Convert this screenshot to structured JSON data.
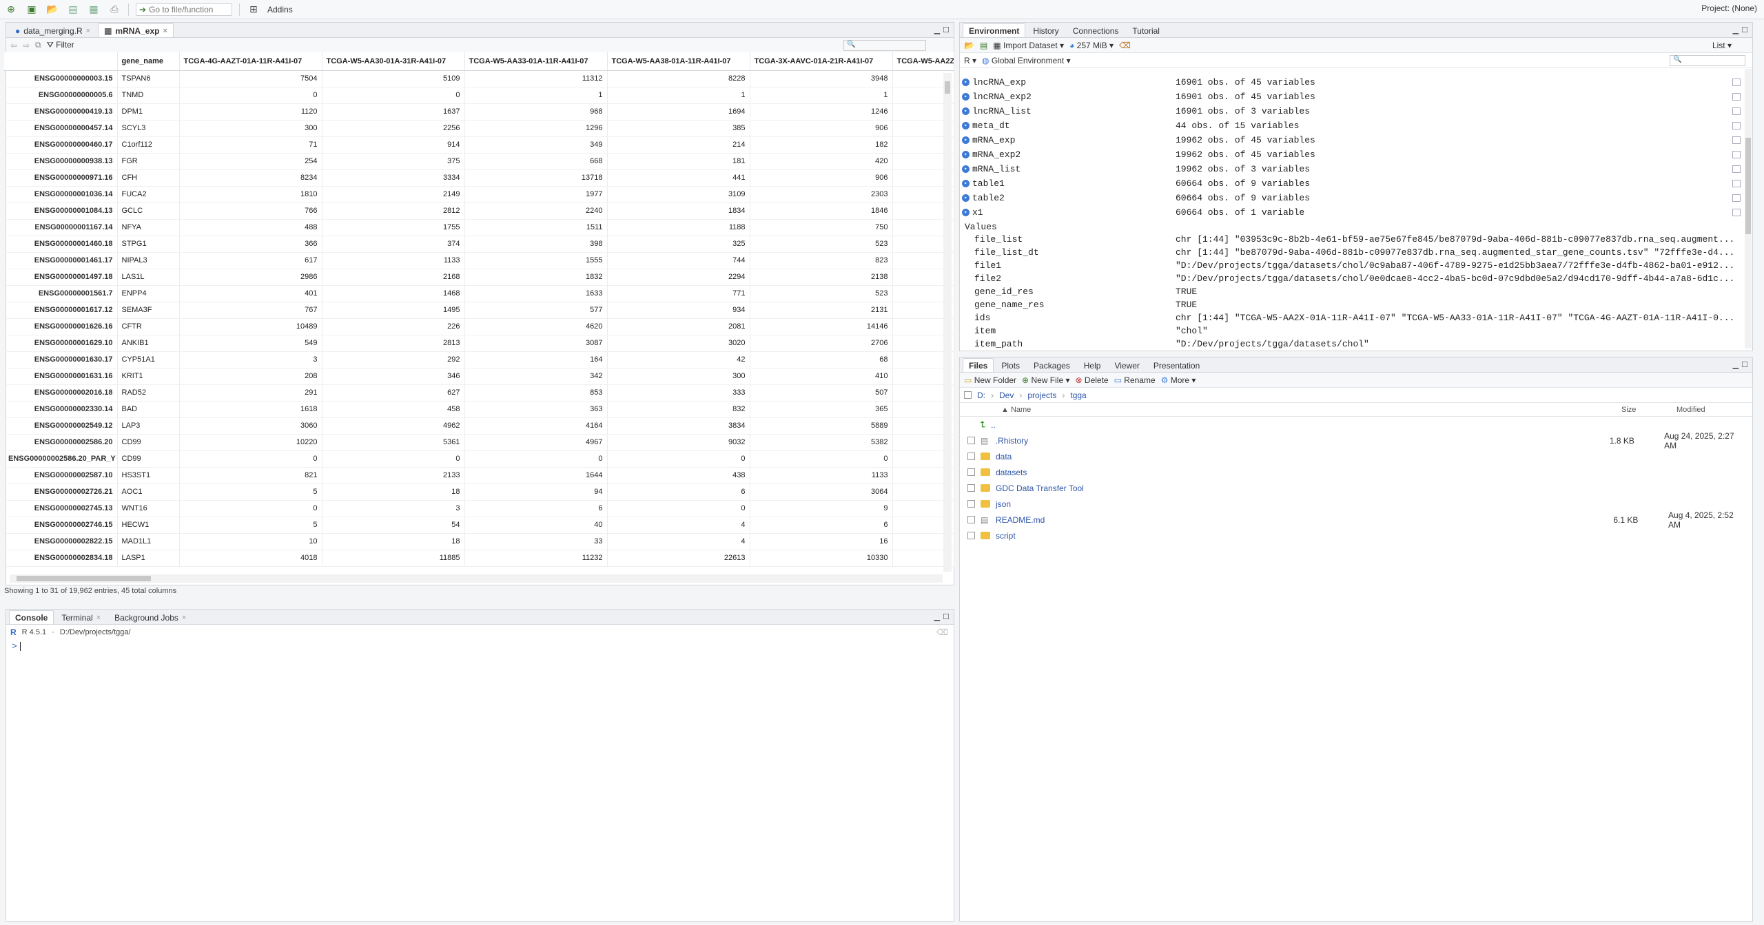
{
  "toolbar": {
    "goto_placeholder": "Go to file/function",
    "addins": "Addins",
    "project": "Project: (None)"
  },
  "source": {
    "tabs": [
      "data_merging.R",
      "mRNA_exp"
    ],
    "filter": "Filter",
    "columns": [
      "gene_name",
      "TCGA-4G-AAZT-01A-11R-A41I-07",
      "TCGA-W5-AA30-01A-31R-A41I-07",
      "TCGA-W5-AA33-01A-11R-A41I-07",
      "TCGA-W5-AA38-01A-11R-A41I-07",
      "TCGA-3X-AAVC-01A-21R-A41I-07",
      "TCGA-W5-AA2Z"
    ],
    "rows": [
      [
        "ENSG00000000003.15",
        "TSPAN6",
        "7504",
        "5109",
        "11312",
        "8228",
        "3948"
      ],
      [
        "ENSG00000000005.6",
        "TNMD",
        "0",
        "0",
        "1",
        "1",
        "1"
      ],
      [
        "ENSG00000000419.13",
        "DPM1",
        "1120",
        "1637",
        "968",
        "1694",
        "1246"
      ],
      [
        "ENSG00000000457.14",
        "SCYL3",
        "300",
        "2256",
        "1296",
        "385",
        "906"
      ],
      [
        "ENSG00000000460.17",
        "C1orf112",
        "71",
        "914",
        "349",
        "214",
        "182"
      ],
      [
        "ENSG00000000938.13",
        "FGR",
        "254",
        "375",
        "668",
        "181",
        "420"
      ],
      [
        "ENSG00000000971.16",
        "CFH",
        "8234",
        "3334",
        "13718",
        "441",
        "906"
      ],
      [
        "ENSG00000001036.14",
        "FUCA2",
        "1810",
        "2149",
        "1977",
        "3109",
        "2303"
      ],
      [
        "ENSG00000001084.13",
        "GCLC",
        "766",
        "2812",
        "2240",
        "1834",
        "1846"
      ],
      [
        "ENSG00000001167.14",
        "NFYA",
        "488",
        "1755",
        "1511",
        "1188",
        "750"
      ],
      [
        "ENSG00000001460.18",
        "STPG1",
        "366",
        "374",
        "398",
        "325",
        "523"
      ],
      [
        "ENSG00000001461.17",
        "NIPAL3",
        "617",
        "1133",
        "1555",
        "744",
        "823"
      ],
      [
        "ENSG00000001497.18",
        "LAS1L",
        "2986",
        "2168",
        "1832",
        "2294",
        "2138"
      ],
      [
        "ENSG00000001561.7",
        "ENPP4",
        "401",
        "1468",
        "1633",
        "771",
        "523"
      ],
      [
        "ENSG00000001617.12",
        "SEMA3F",
        "767",
        "1495",
        "577",
        "934",
        "2131"
      ],
      [
        "ENSG00000001626.16",
        "CFTR",
        "10489",
        "226",
        "4620",
        "2081",
        "14146"
      ],
      [
        "ENSG00000001629.10",
        "ANKIB1",
        "549",
        "2813",
        "3087",
        "3020",
        "2706"
      ],
      [
        "ENSG00000001630.17",
        "CYP51A1",
        "3",
        "292",
        "164",
        "42",
        "68"
      ],
      [
        "ENSG00000001631.16",
        "KRIT1",
        "208",
        "346",
        "342",
        "300",
        "410"
      ],
      [
        "ENSG00000002016.18",
        "RAD52",
        "291",
        "627",
        "853",
        "333",
        "507"
      ],
      [
        "ENSG00000002330.14",
        "BAD",
        "1618",
        "458",
        "363",
        "832",
        "365"
      ],
      [
        "ENSG00000002549.12",
        "LAP3",
        "3060",
        "4962",
        "4164",
        "3834",
        "5889"
      ],
      [
        "ENSG00000002586.20",
        "CD99",
        "10220",
        "5361",
        "4967",
        "9032",
        "5382"
      ],
      [
        "ENSG00000002586.20_PAR_Y",
        "CD99",
        "0",
        "0",
        "0",
        "0",
        "0"
      ],
      [
        "ENSG00000002587.10",
        "HS3ST1",
        "821",
        "2133",
        "1644",
        "438",
        "1133"
      ],
      [
        "ENSG00000002726.21",
        "AOC1",
        "5",
        "18",
        "94",
        "6",
        "3064"
      ],
      [
        "ENSG00000002745.13",
        "WNT16",
        "0",
        "3",
        "6",
        "0",
        "9"
      ],
      [
        "ENSG00000002746.15",
        "HECW1",
        "5",
        "54",
        "40",
        "4",
        "6"
      ],
      [
        "ENSG00000002822.15",
        "MAD1L1",
        "10",
        "18",
        "33",
        "4",
        "16"
      ],
      [
        "ENSG00000002834.18",
        "LASP1",
        "4018",
        "11885",
        "11232",
        "22613",
        "10330"
      ]
    ],
    "footer": "Showing 1 to 31 of 19,962 entries, 45 total columns"
  },
  "console": {
    "tabs": [
      "Console",
      "Terminal",
      "Background Jobs"
    ],
    "version": "R 4.5.1",
    "path": "D:/Dev/projects/tgga/",
    "prompt": ">"
  },
  "env": {
    "tabs": [
      "Environment",
      "History",
      "Connections",
      "Tutorial"
    ],
    "import_label": "Import Dataset",
    "mem": "257 MiB",
    "list_label": "List",
    "lang": "R",
    "scope": "Global Environment",
    "data_rows": [
      [
        "lncRNA_exp",
        "16901 obs. of 45 variables"
      ],
      [
        "lncRNA_exp2",
        "16901 obs. of 45 variables"
      ],
      [
        "lncRNA_list",
        "16901 obs. of 3 variables"
      ],
      [
        "meta_dt",
        "44 obs. of 15 variables"
      ],
      [
        "mRNA_exp",
        "19962 obs. of 45 variables"
      ],
      [
        "mRNA_exp2",
        "19962 obs. of 45 variables"
      ],
      [
        "mRNA_list",
        "19962 obs. of 3 variables"
      ],
      [
        "table1",
        "60664 obs. of 9 variables"
      ],
      [
        "table2",
        "60664 obs. of 9 variables"
      ],
      [
        "x1",
        "60664 obs. of 1 variable"
      ]
    ],
    "values_header": "Values",
    "values_rows": [
      [
        "file_list",
        "chr [1:44] \"03953c9c-8b2b-4e61-bf59-ae75e67fe845/be87079d-9aba-406d-881b-c09077e837db.rna_seq.augment..."
      ],
      [
        "file_list_dt",
        "chr [1:44] \"be87079d-9aba-406d-881b-c09077e837db.rna_seq.augmented_star_gene_counts.tsv\" \"72fffe3e-d4..."
      ],
      [
        "file1",
        "\"D:/Dev/projects/tgga/datasets/chol/0c9aba87-406f-4789-9275-e1d25bb3aea7/72fffe3e-d4fb-4862-ba01-e912..."
      ],
      [
        "file2",
        "\"D:/Dev/projects/tgga/datasets/chol/0e0dcae8-4cc2-4ba5-bc0d-07c9dbd0e5a2/d94cd170-9dff-4b44-a7a8-6d1c..."
      ],
      [
        "gene_id_res",
        "TRUE"
      ],
      [
        "gene_name_res",
        "TRUE"
      ],
      [
        "ids",
        "chr [1:44] \"TCGA-W5-AA2X-01A-11R-A41I-07\" \"TCGA-W5-AA33-01A-11R-A41I-07\" \"TCGA-4G-AAZT-01A-11R-A41I-0..."
      ],
      [
        "item",
        "\"chol\""
      ],
      [
        "item_path",
        "\"D:/Dev/projects/tgga/datasets/chol\""
      ]
    ]
  },
  "files": {
    "tabs": [
      "Files",
      "Plots",
      "Packages",
      "Help",
      "Viewer",
      "Presentation"
    ],
    "new_folder": "New Folder",
    "new_file": "New File",
    "delete": "Delete",
    "rename": "Rename",
    "more": "More",
    "breadcrumb": [
      "D:",
      "Dev",
      "projects",
      "tgga"
    ],
    "headers": [
      "Name",
      "Size",
      "Modified"
    ],
    "up": "..",
    "items": [
      [
        ".Rhistory",
        "1.8 KB",
        "Aug 24, 2025, 2:27 AM"
      ],
      [
        "data",
        "",
        ""
      ],
      [
        "datasets",
        "",
        ""
      ],
      [
        "GDC Data Transfer Tool",
        "",
        ""
      ],
      [
        "json",
        "",
        ""
      ],
      [
        "README.md",
        "6.1 KB",
        "Aug 4, 2025, 2:52 AM"
      ],
      [
        "script",
        "",
        ""
      ]
    ]
  }
}
